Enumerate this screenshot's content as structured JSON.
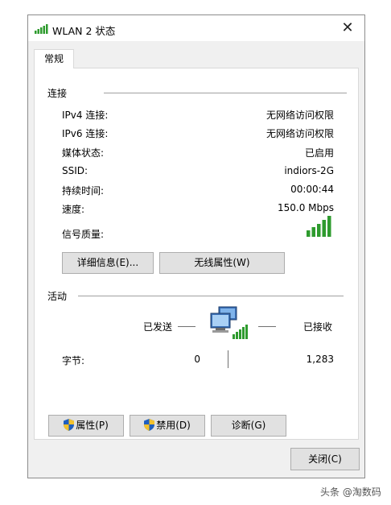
{
  "window": {
    "title": "WLAN 2 状态",
    "close_label": "关闭(C)"
  },
  "tabs": [
    {
      "label": "常规"
    }
  ],
  "connection": {
    "heading": "连接",
    "rows": [
      {
        "label": "IPv4 连接:",
        "value": "无网络访问权限"
      },
      {
        "label": "IPv6 连接:",
        "value": "无网络访问权限"
      },
      {
        "label": "媒体状态:",
        "value": "已启用"
      },
      {
        "label": "SSID:",
        "value": "indiors-2G"
      },
      {
        "label": "持续时间:",
        "value": "00:00:44"
      },
      {
        "label": "速度:",
        "value": "150.0 Mbps"
      }
    ],
    "signal_label": "信号质量:",
    "signal_bars": 5,
    "signal_color": "#2e9b2e",
    "details_button": "详细信息(E)...",
    "wireless_props_button": "无线属性(W)"
  },
  "activity": {
    "heading": "活动",
    "sent_label": "已发送",
    "received_label": "已接收",
    "bytes_label": "字节:",
    "bytes_sent": "0",
    "bytes_received": "1,283"
  },
  "buttons": {
    "properties": "属性(P)",
    "disable": "禁用(D)",
    "diagnose": "诊断(G)"
  },
  "watermark": "头条 @淘数码"
}
